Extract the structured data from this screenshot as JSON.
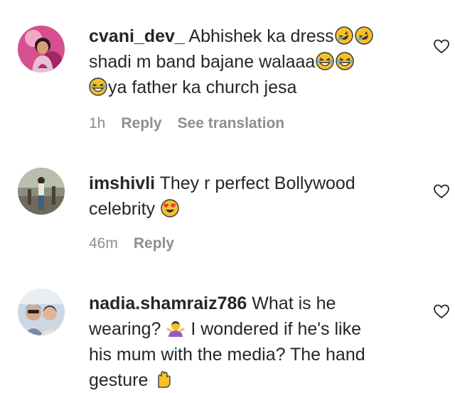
{
  "comments": [
    {
      "username": "cvani_dev_",
      "line1_pre": "Abhishek ka dress",
      "line2_pre": "shadi m band bajane walaaa",
      "line3_post": "ya father ka church jesa",
      "time": "1h",
      "reply": "Reply",
      "see_translation": "See translation",
      "emojis": [
        "rolling-on-floor-laughing",
        "rolling-on-floor-laughing",
        "grinning-squinting",
        "grinning-squinting",
        "grinning-squinting"
      ]
    },
    {
      "username": "imshivli",
      "line1": "They r perfect Bollywood",
      "line2": "celebrity",
      "time": "46m",
      "reply": "Reply",
      "emojis": [
        "heart-eyes"
      ]
    },
    {
      "username": "nadia.shamraiz786",
      "line1": "What is he",
      "line2_pre": "wearing?",
      "line2_post": "I wondered if he's like",
      "line3": "his mum with the media? The hand",
      "line4": "gesture",
      "emojis": [
        "person-shrugging",
        "raised-hand"
      ]
    }
  ],
  "colors": {
    "text": "#262626",
    "meta": "#8e8e8e",
    "emoji_yellow": "#f7c02b",
    "heart_red": "#e8352b"
  }
}
